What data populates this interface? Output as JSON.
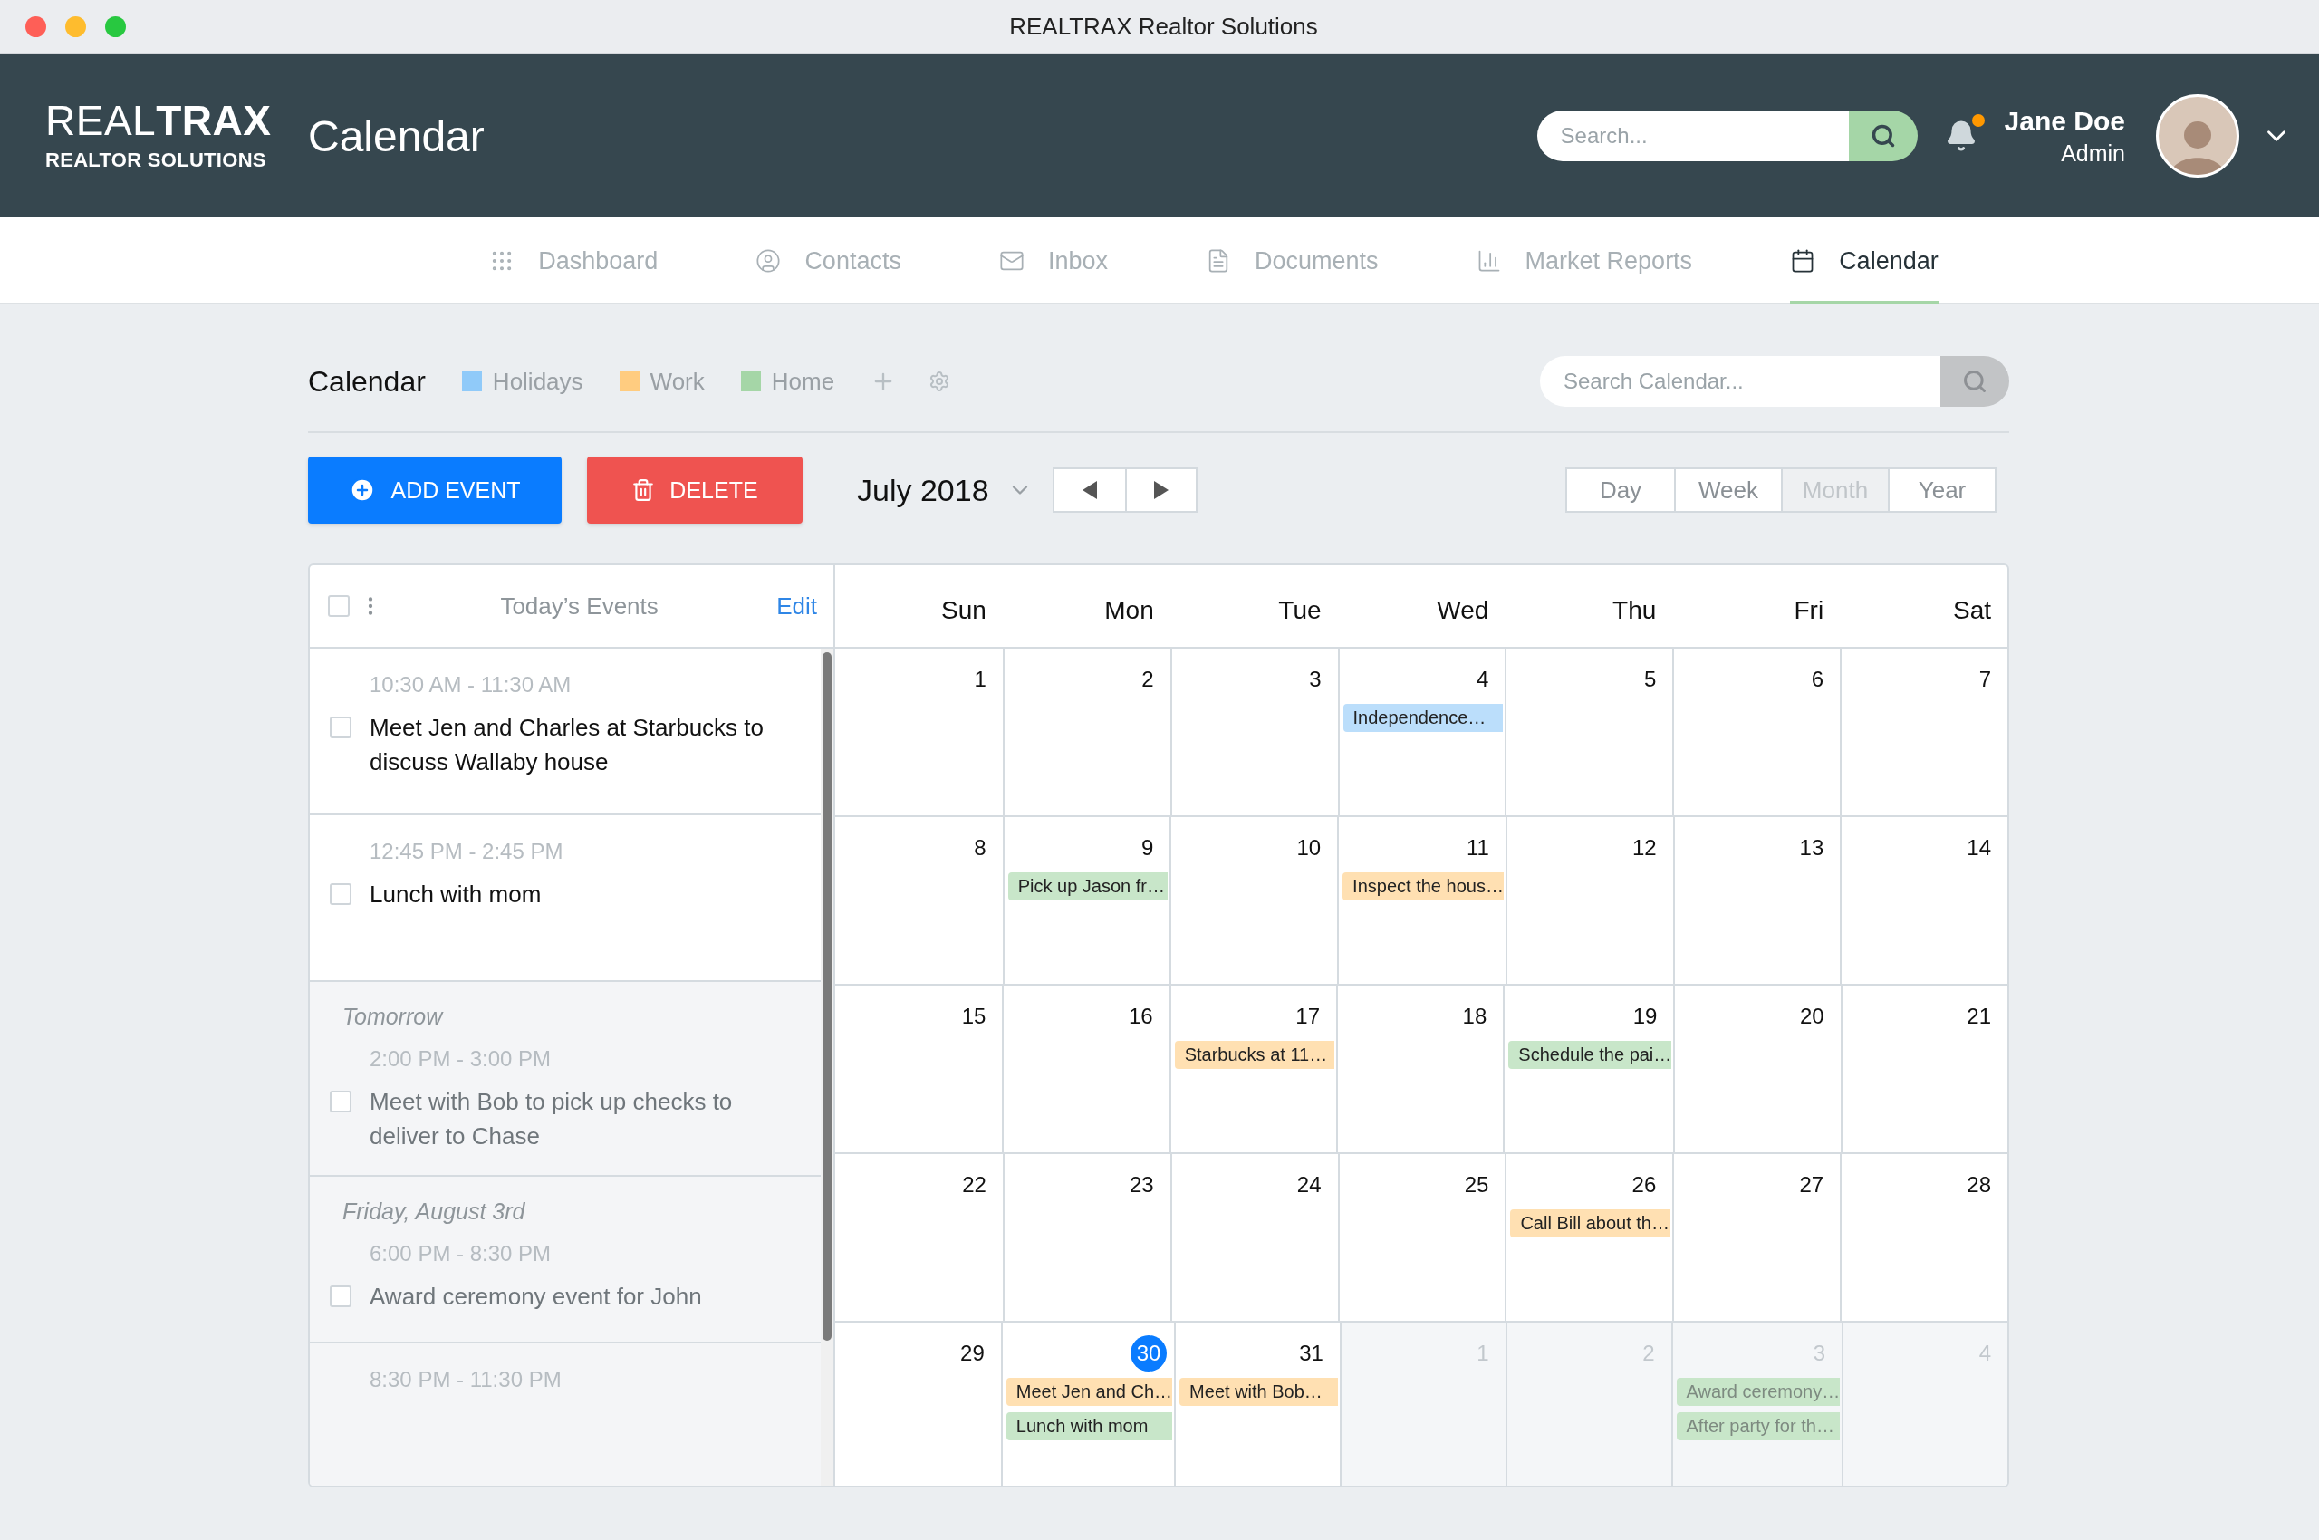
{
  "window": {
    "title": "REALTRAX Realtor Solutions"
  },
  "header": {
    "logo": "REAL**TRAX**",
    "tagline": "REALTOR SOLUTIONS",
    "page_title": "Calendar",
    "search": {
      "placeholder": "Search..."
    },
    "notifications": {
      "unread": true
    },
    "user": {
      "name": "Jane Doe",
      "role": "Admin"
    }
  },
  "nav": [
    {
      "label": "Dashboard",
      "selected": false
    },
    {
      "label": "Contacts",
      "selected": false
    },
    {
      "label": "Inbox",
      "selected": false
    },
    {
      "label": "Documents",
      "selected": false
    },
    {
      "label": "Market Reports",
      "selected": false
    },
    {
      "label": "Calendar",
      "selected": true
    }
  ],
  "toolbar": {
    "title": "Calendar",
    "calendars": [
      {
        "label": "Holidays",
        "color": "#90caf9"
      },
      {
        "label": "Work",
        "color": "#ffcc80"
      },
      {
        "label": "Home",
        "color": "#a5d6a7"
      }
    ],
    "search": {
      "placeholder": "Search Calendar..."
    }
  },
  "actions": {
    "add": "ADD EVENT",
    "delete": "DELETE",
    "month": "July 2018",
    "views": [
      {
        "label": "Day",
        "selected": false
      },
      {
        "label": "Week",
        "selected": false
      },
      {
        "label": "Month",
        "selected": true
      },
      {
        "label": "Year",
        "selected": false
      }
    ]
  },
  "events_panel": {
    "title": "Today’s Events",
    "edit": "Edit",
    "select_all": false,
    "sections": [
      {
        "kind": "today",
        "events": [
          {
            "time": "10:30 AM - 11:30 AM",
            "title": "Meet Jen and Charles at Starbucks to discuss Wallaby house",
            "checked": false
          }
        ]
      },
      {
        "kind": "today",
        "events": [
          {
            "time": "12:45 PM - 2:45 PM",
            "title": "Lunch with mom",
            "checked": false
          }
        ]
      },
      {
        "kind": "upcoming",
        "heading": "Tomorrow",
        "events": [
          {
            "time": "2:00 PM - 3:00 PM",
            "title": "Meet with Bob to pick up checks to deliver to Chase",
            "checked": false
          }
        ]
      },
      {
        "kind": "upcoming",
        "heading": "Friday, August 3rd",
        "events": [
          {
            "time": "6:00 PM - 8:30 PM",
            "title": "Award ceremony event for John",
            "checked": false
          }
        ]
      },
      {
        "kind": "upcoming",
        "events": [
          {
            "time": "8:30 PM - 11:30 PM"
          }
        ]
      }
    ]
  },
  "calendar": {
    "weekdays": [
      "Sun",
      "Mon",
      "Tue",
      "Wed",
      "Thu",
      "Fri",
      "Sat"
    ],
    "weeks": [
      [
        {
          "day": "1",
          "in_month": true
        },
        {
          "day": "2",
          "in_month": true
        },
        {
          "day": "3",
          "in_month": true
        },
        {
          "day": "4",
          "in_month": true,
          "events": [
            {
              "title": "Independence…",
              "color": "#bbdefb"
            }
          ]
        },
        {
          "day": "5",
          "in_month": true
        },
        {
          "day": "6",
          "in_month": true
        },
        {
          "day": "7",
          "in_month": true
        }
      ],
      [
        {
          "day": "8",
          "in_month": true
        },
        {
          "day": "9",
          "in_month": true,
          "events": [
            {
              "title": "Pick up Jason fr…",
              "color": "#c8e6c9"
            }
          ]
        },
        {
          "day": "10",
          "in_month": true
        },
        {
          "day": "11",
          "in_month": true,
          "events": [
            {
              "title": "Inspect the hous…",
              "color": "#ffe0b2"
            }
          ]
        },
        {
          "day": "12",
          "in_month": true
        },
        {
          "day": "13",
          "in_month": true
        },
        {
          "day": "14",
          "in_month": true
        }
      ],
      [
        {
          "day": "15",
          "in_month": true
        },
        {
          "day": "16",
          "in_month": true
        },
        {
          "day": "17",
          "in_month": true,
          "events": [
            {
              "title": "Starbucks at 11…",
              "color": "#ffe0b2"
            }
          ]
        },
        {
          "day": "18",
          "in_month": true
        },
        {
          "day": "19",
          "in_month": true,
          "events": [
            {
              "title": "Schedule the pai…",
              "color": "#c8e6c9"
            }
          ]
        },
        {
          "day": "20",
          "in_month": true
        },
        {
          "day": "21",
          "in_month": true
        }
      ],
      [
        {
          "day": "22",
          "in_month": true
        },
        {
          "day": "23",
          "in_month": true
        },
        {
          "day": "24",
          "in_month": true
        },
        {
          "day": "25",
          "in_month": true
        },
        {
          "day": "26",
          "in_month": true,
          "events": [
            {
              "title": "Call Bill about th…",
              "color": "#ffe0b2"
            }
          ]
        },
        {
          "day": "27",
          "in_month": true
        },
        {
          "day": "28",
          "in_month": true
        }
      ],
      [
        {
          "day": "29",
          "in_month": true
        },
        {
          "day": "30",
          "in_month": true,
          "today": true,
          "events": [
            {
              "title": "Meet Jen and Ch…",
              "color": "#ffe0b2"
            },
            {
              "title": "Lunch with mom",
              "color": "#c8e6c9"
            }
          ]
        },
        {
          "day": "31",
          "in_month": true,
          "events": [
            {
              "title": "Meet with Bob…",
              "color": "#ffe0b2"
            }
          ]
        },
        {
          "day": "1",
          "in_month": false
        },
        {
          "day": "2",
          "in_month": false
        },
        {
          "day": "3",
          "in_month": false,
          "events": [
            {
              "title": "Award ceremony…",
              "color": "#c8e6c9"
            },
            {
              "title": "After party for th…",
              "color": "#c8e6c9"
            }
          ]
        },
        {
          "day": "4",
          "in_month": false
        }
      ]
    ]
  }
}
